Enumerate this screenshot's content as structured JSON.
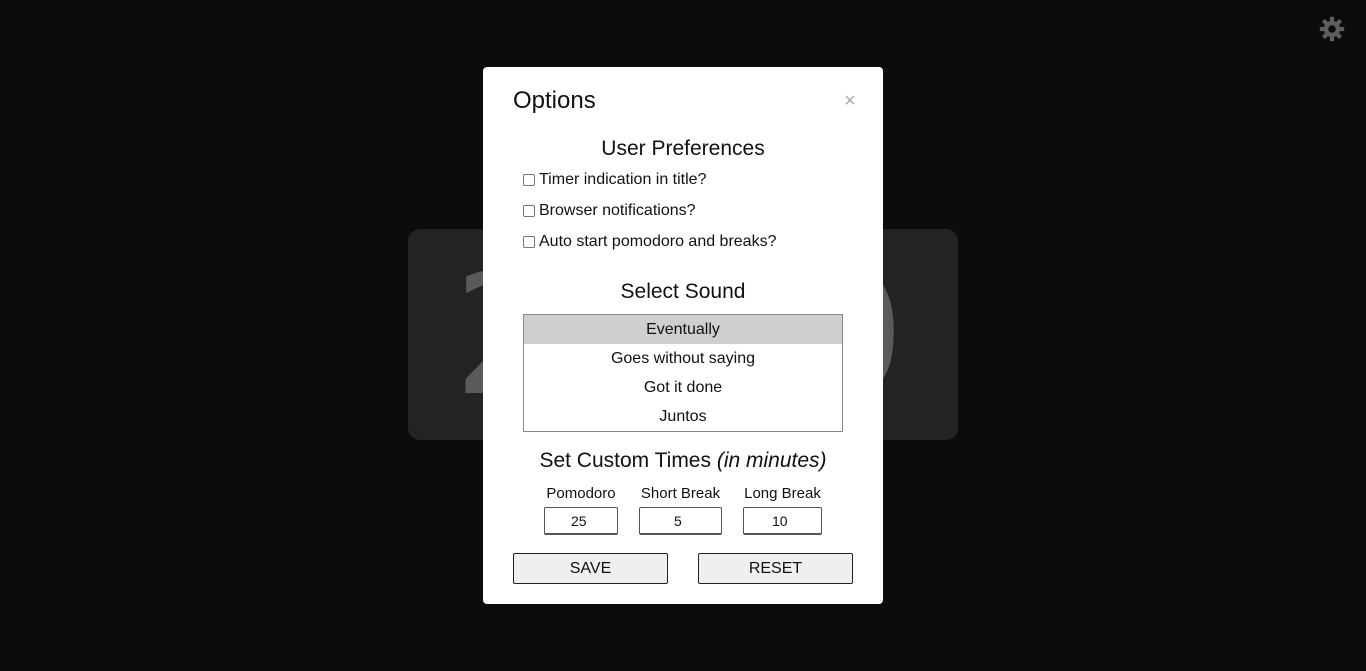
{
  "background": {
    "timer_digit_left": "2",
    "timer_digit_right": "0"
  },
  "settings_icon": "gear-icon",
  "modal": {
    "title": "Options",
    "close_glyph": "×",
    "preferences": {
      "title": "User Preferences",
      "items": [
        {
          "label": "Timer indication in title?",
          "checked": false
        },
        {
          "label": "Browser notifications?",
          "checked": false
        },
        {
          "label": "Auto start pomodoro and breaks?",
          "checked": false
        }
      ]
    },
    "sound": {
      "title": "Select Sound",
      "options": [
        "Eventually",
        "Goes without saying",
        "Got it done",
        "Juntos"
      ],
      "selected": "Eventually"
    },
    "custom_times": {
      "title": "Set Custom Times",
      "subtitle": "(in minutes)",
      "fields": [
        {
          "label": "Pomodoro",
          "value": "25"
        },
        {
          "label": "Short Break",
          "value": "5"
        },
        {
          "label": "Long Break",
          "value": "10"
        }
      ]
    },
    "save_label": "SAVE",
    "reset_label": "RESET"
  },
  "colors": {
    "page_background": "#0c0c0c",
    "timer_card": "#232323",
    "selected_option": "#cfcfcf"
  }
}
